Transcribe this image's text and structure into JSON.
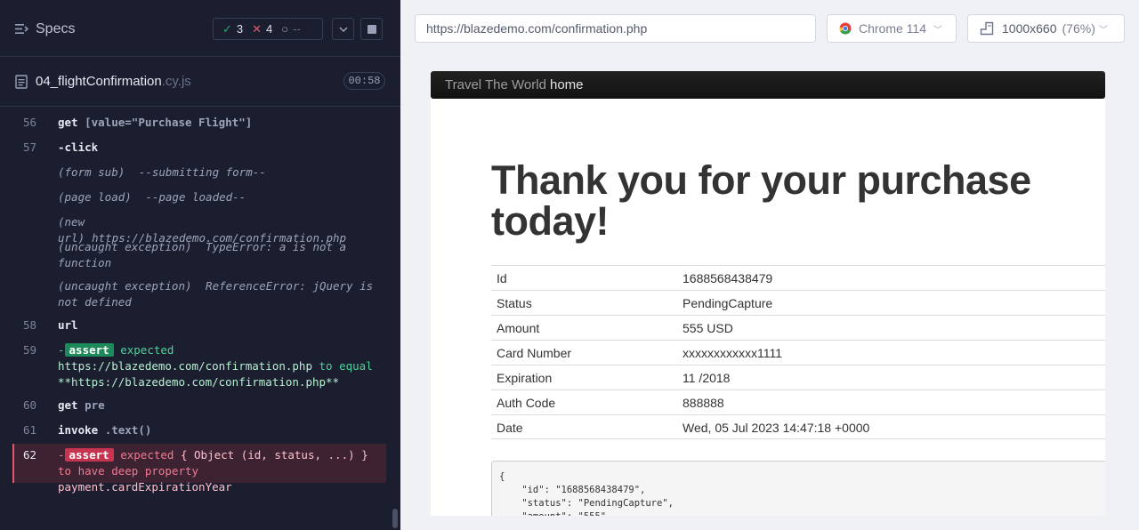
{
  "sidebar": {
    "title": "Specs",
    "stats": {
      "passed": "3",
      "failed": "4",
      "pending": "--"
    },
    "file": {
      "name": "04_flightConfirmation",
      "ext": ".cy.js",
      "duration": "00:58"
    }
  },
  "log": {
    "c56": {
      "line": "56",
      "name": "get",
      "arg": "[value=\"Purchase Flight\"]"
    },
    "c57": {
      "line": "57",
      "name": "-click"
    },
    "e1": {
      "tag": "(form sub)",
      "text": "--submitting form--"
    },
    "e2": {
      "tag": "(page load)",
      "text": "--page loaded--"
    },
    "e3": {
      "tag": "(new url)",
      "text": "https://blazedemo.com/confirmation.php"
    },
    "e4": {
      "tag": "(uncaught exception)",
      "text": "TypeError: a is not a function"
    },
    "e5": {
      "tag": "(uncaught exception)",
      "text": "ReferenceError: jQuery is not defined"
    },
    "c58": {
      "line": "58",
      "name": "url"
    },
    "c59": {
      "line": "59",
      "dash": "-",
      "badge": "assert",
      "expected": "expected",
      "actual": "https://blazedemo.com/confirmation.php",
      "op": "to equal",
      "value": "**https://blazedemo.com/confirmation.php**"
    },
    "c60": {
      "line": "60",
      "name": "get",
      "arg": "pre"
    },
    "c61": {
      "line": "61",
      "name": "invoke",
      "arg": ".text()"
    },
    "c62": {
      "line": "62",
      "dash": "-",
      "badge": "assert",
      "expected": "expected",
      "actual": "{ Object (id, status, ...) }",
      "op": "to have deep property",
      "value": "payment.cardExpirationYear"
    }
  },
  "toolbar": {
    "url": "https://blazedemo.com/confirmation.php",
    "browser": "Chrome 114",
    "viewport": "1000x660",
    "zoom": "(76%)"
  },
  "aut": {
    "brand": "Travel The World",
    "home": "home",
    "heading": "Thank you for your purchase today!",
    "rows": [
      {
        "k": "Id",
        "v": "1688568438479"
      },
      {
        "k": "Status",
        "v": "PendingCapture"
      },
      {
        "k": "Amount",
        "v": "555 USD"
      },
      {
        "k": "Card Number",
        "v": "xxxxxxxxxxxx1111"
      },
      {
        "k": "Expiration",
        "v": "11 /2018"
      },
      {
        "k": "Auth Code",
        "v": "888888"
      },
      {
        "k": "Date",
        "v": "Wed, 05 Jul 2023 14:47:18 +0000"
      }
    ],
    "pre": "{\n    \"id\": \"1688568438479\",\n    \"status\": \"PendingCapture\",\n    \"amount\": \"555\","
  }
}
